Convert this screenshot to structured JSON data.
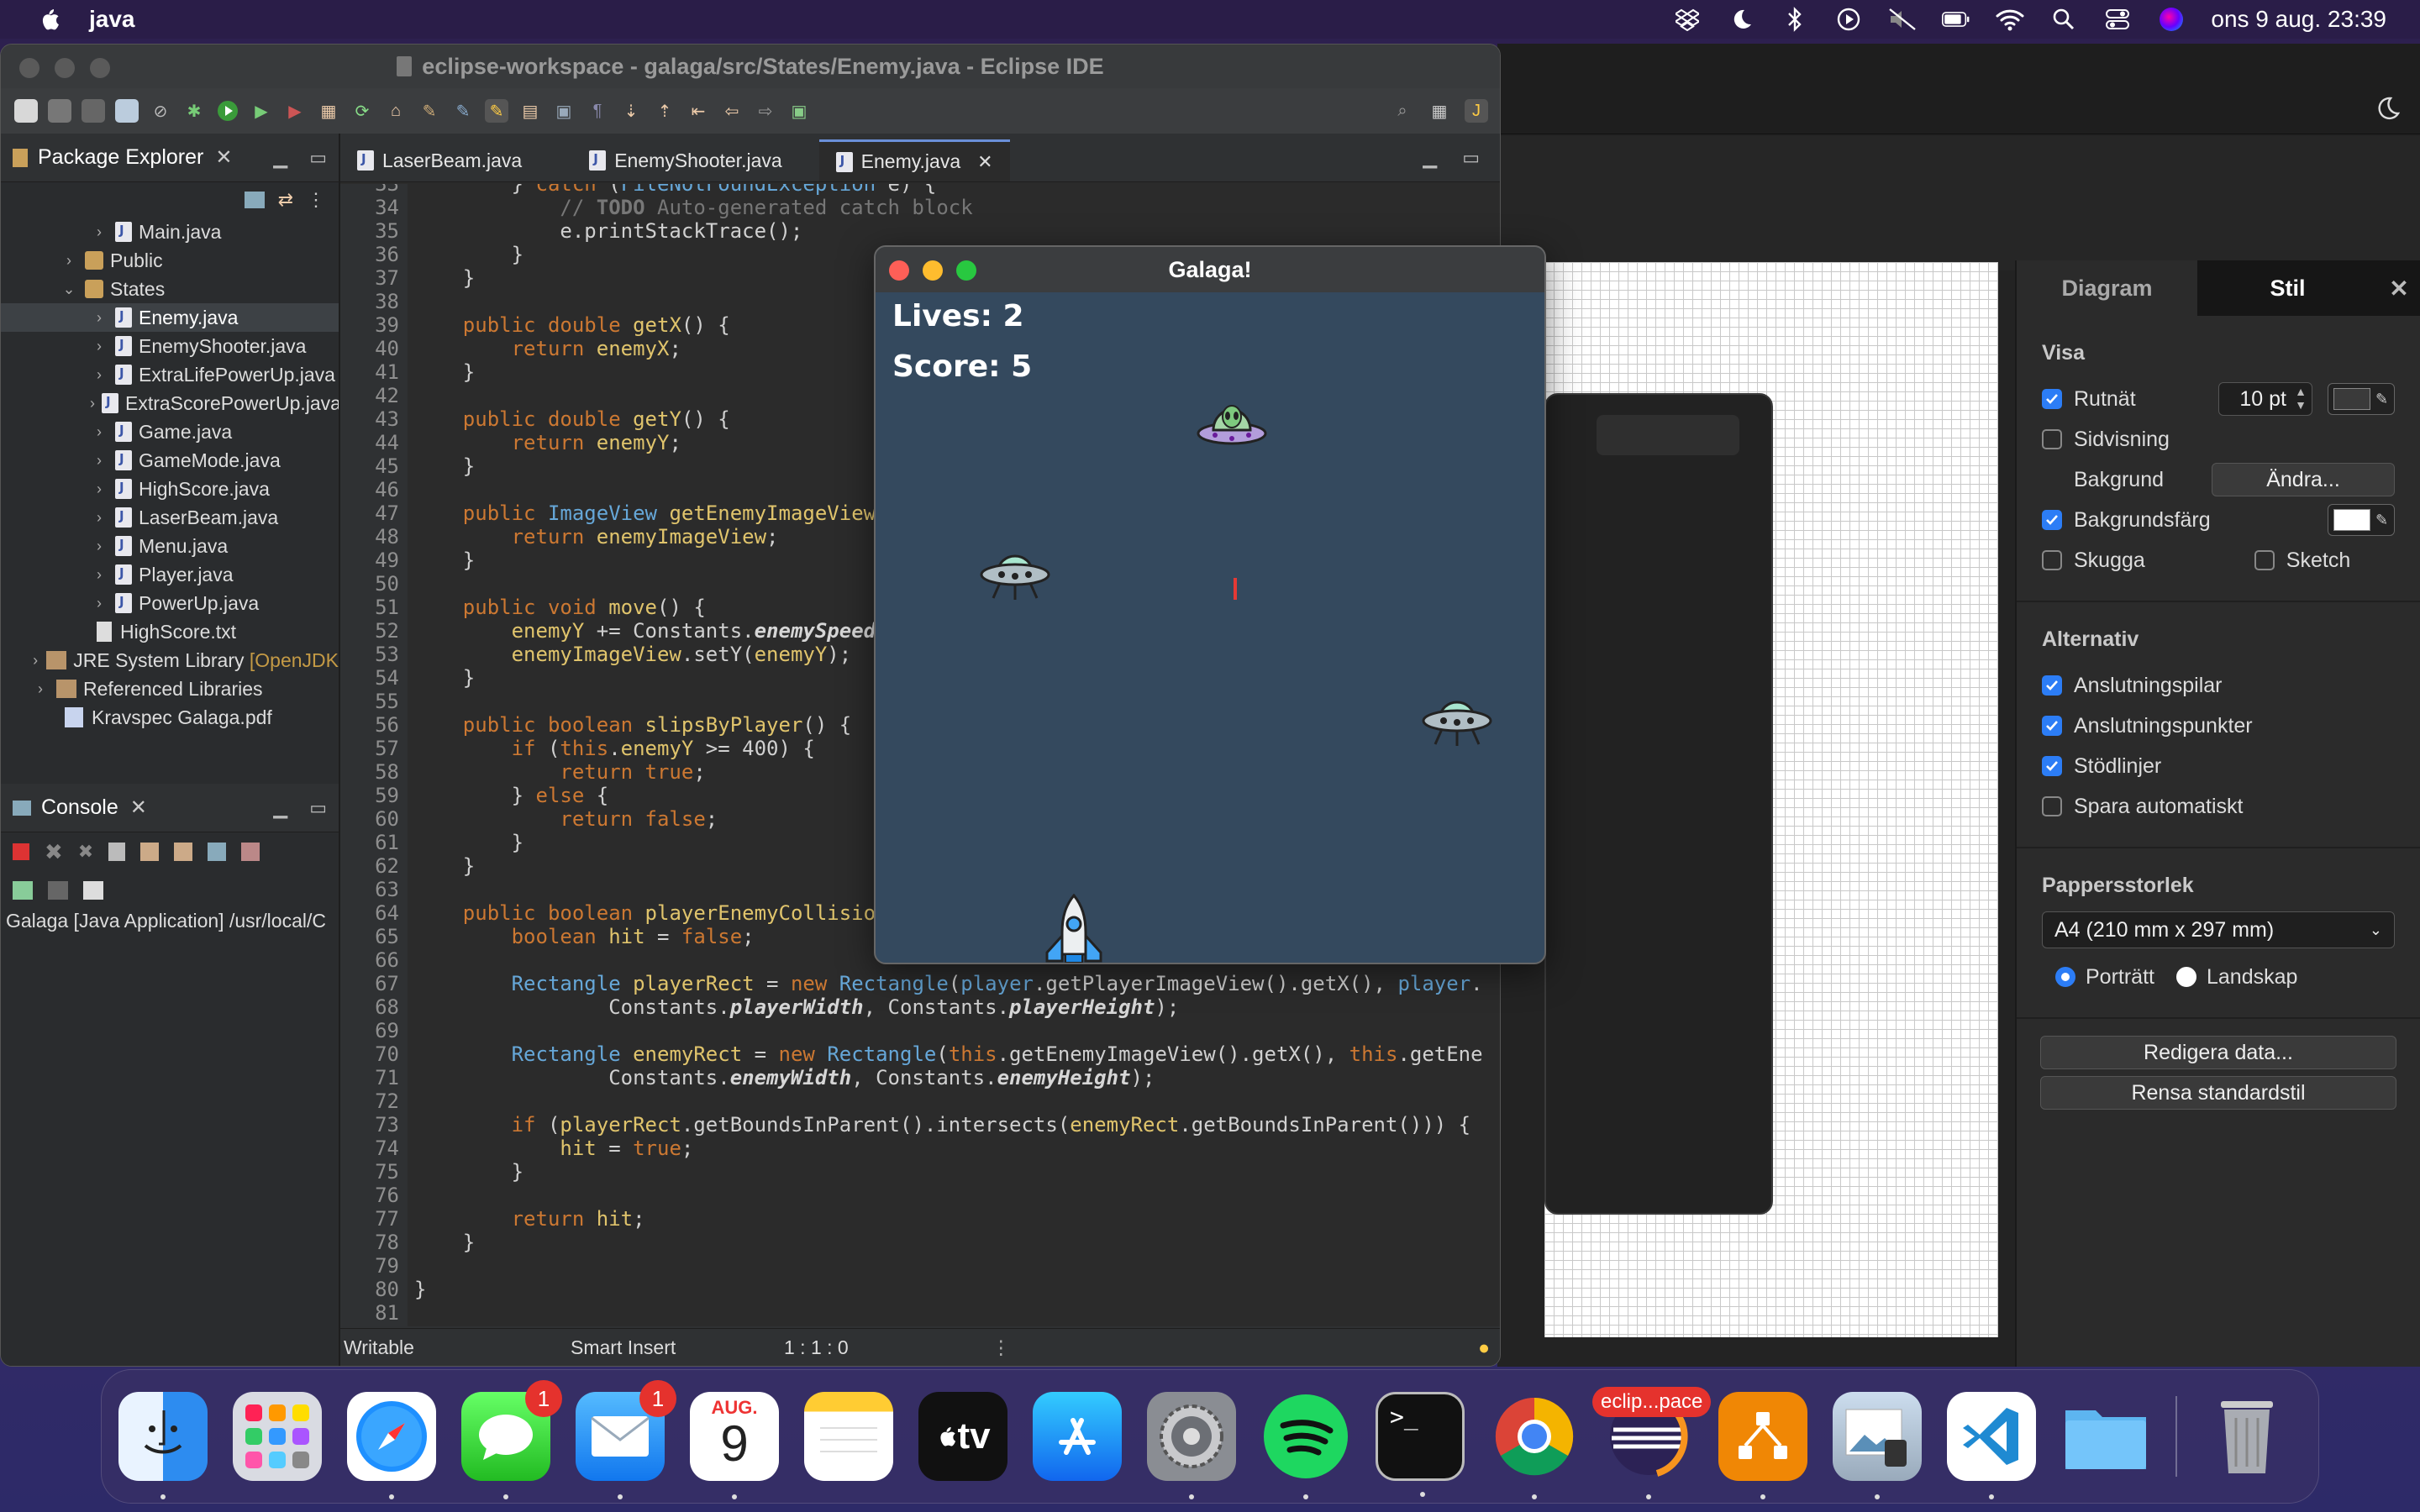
{
  "menubar": {
    "app_name": "java",
    "datetime": "ons 9 aug.  23:39"
  },
  "eclipse": {
    "title": "eclipse-workspace - galaga/src/States/Enemy.java - Eclipse IDE",
    "package_explorer": {
      "label": "Package Explorer",
      "items": [
        {
          "label": "Main.java"
        },
        {
          "label": "Public"
        },
        {
          "label": "States"
        },
        {
          "label": "Enemy.java"
        },
        {
          "label": "EnemyShooter.java"
        },
        {
          "label": "ExtraLifePowerUp.java"
        },
        {
          "label": "ExtraScorePowerUp.java"
        },
        {
          "label": "Game.java"
        },
        {
          "label": "GameMode.java"
        },
        {
          "label": "HighScore.java"
        },
        {
          "label": "LaserBeam.java"
        },
        {
          "label": "Menu.java"
        },
        {
          "label": "Player.java"
        },
        {
          "label": "PowerUp.java"
        },
        {
          "label": "HighScore.txt"
        },
        {
          "label": "JRE System Library",
          "suffix": "[OpenJDK"
        },
        {
          "label": "Referenced Libraries"
        },
        {
          "label": "Kravspec Galaga.pdf"
        }
      ]
    },
    "console": {
      "label": "Console",
      "line": "Galaga [Java Application] /usr/local/C"
    },
    "tabs": [
      {
        "label": "LaserBeam.java"
      },
      {
        "label": "EnemyShooter.java"
      },
      {
        "label": "Enemy.java"
      }
    ],
    "status": {
      "mode": "Writable",
      "insert": "Smart Insert",
      "position": "1 : 1 : 0"
    }
  },
  "galaga": {
    "title": "Galaga!",
    "lives": "Lives: 2",
    "score": "Score: 5"
  },
  "drawio": {
    "tab_diagram": "Diagram",
    "tab_style": "Stil",
    "visa": {
      "heading": "Visa",
      "grid": "Rutnät",
      "grid_size": "10 pt",
      "page_view": "Sidvisning",
      "background": "Bakgrund",
      "change": "Ändra...",
      "background_color": "Bakgrundsfärg",
      "shadow": "Skugga",
      "sketch": "Sketch"
    },
    "alternativ": {
      "heading": "Alternativ",
      "arrows": "Anslutningspilar",
      "points": "Anslutningspunkter",
      "guides": "Stödlinjer",
      "autosave": "Spara automatiskt"
    },
    "paper": {
      "heading": "Pappersstorlek",
      "size": "A4 (210 mm x 297 mm)",
      "portrait": "Porträtt",
      "landscape": "Landskap"
    },
    "edit_data": "Redigera data...",
    "clear_style": "Rensa standardstil"
  },
  "dock": {
    "mail_badge": "1",
    "messages_badge": "1",
    "calendar_month": "AUG.",
    "calendar_day": "9",
    "eclipse_label": "eclip...pace"
  }
}
